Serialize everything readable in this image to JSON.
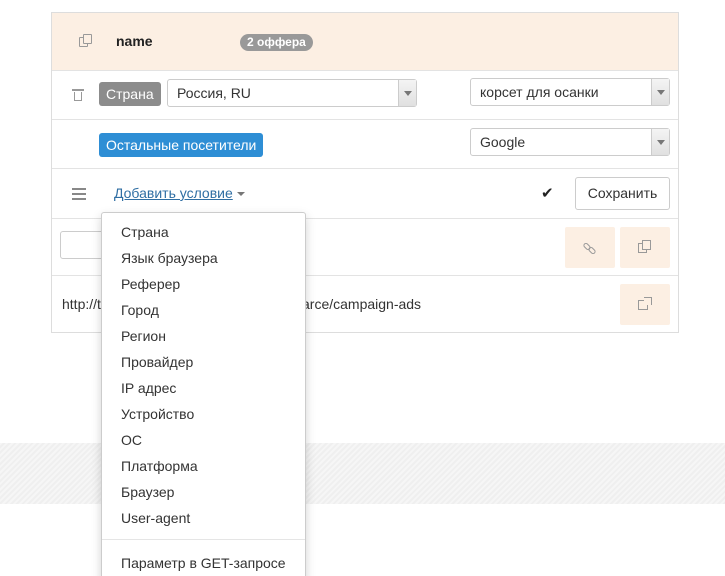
{
  "offer_group": {
    "name": "name",
    "offers_badge": "2 оффера"
  },
  "rule_1": {
    "condition_tag": "Страна",
    "country_value": "Россия, RU",
    "offer_value": "корсет для осанки"
  },
  "rule_2": {
    "condition_tag": "Остальные посетители",
    "offer_value": "Google"
  },
  "actions_row": {
    "add_condition_label": "Добавить условие",
    "save_label": "Сохранить"
  },
  "url_row": {
    "url_left": "http://t",
    "url_right": "arce/campaign-ads"
  },
  "condition_menu": {
    "items": [
      "Страна",
      "Язык браузера",
      "Реферер",
      "Город",
      "Регион",
      "Провайдер",
      "IP адрес",
      "Устройство",
      "ОС",
      "Платформа",
      "Браузер",
      "User-agent"
    ],
    "extra_items": [
      "Параметр в GET-запросе"
    ]
  },
  "colors": {
    "header_bg": "#fcefe3",
    "tag_gray": "#8c8c8c",
    "tag_blue": "#2e8ed5",
    "link": "#2f6ea3"
  },
  "icons": [
    "copy-icon",
    "trash-icon",
    "menu-icon",
    "check-icon",
    "link-icon",
    "duplicate-icon",
    "external-link-icon",
    "chevron-down-icon"
  ]
}
